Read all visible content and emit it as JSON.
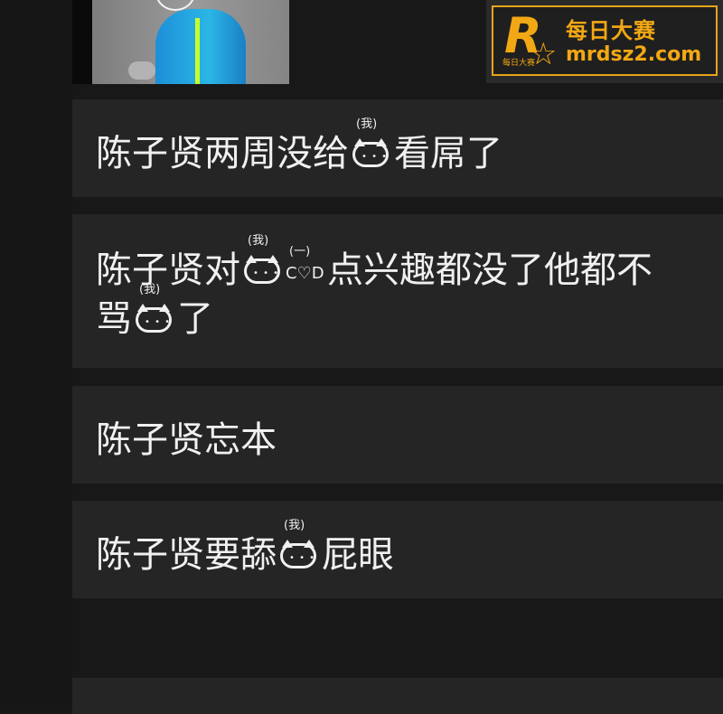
{
  "logo": {
    "letter": "R",
    "small_text": "每日大赛",
    "title": "每日大赛",
    "domain": "mrdsz2.com"
  },
  "messages": [
    {
      "segments_before": "陈子贤两周没给",
      "kitty_tag": "(我)",
      "segments_after": "看屌了"
    },
    {
      "line1_before": "陈子贤对",
      "kitty_tag": "(我)",
      "heart_tag": "(一)",
      "heart_text": "C♡D",
      "line1_after": "点兴趣都没了他都不",
      "line2_before": "骂",
      "line2_kitty_tag": "(我)",
      "line2_after": "了"
    },
    {
      "text": "陈子贤忘本"
    },
    {
      "segments_before": "陈子贤要舔",
      "kitty_tag": "(我)",
      "segments_after": "屁眼"
    }
  ]
}
